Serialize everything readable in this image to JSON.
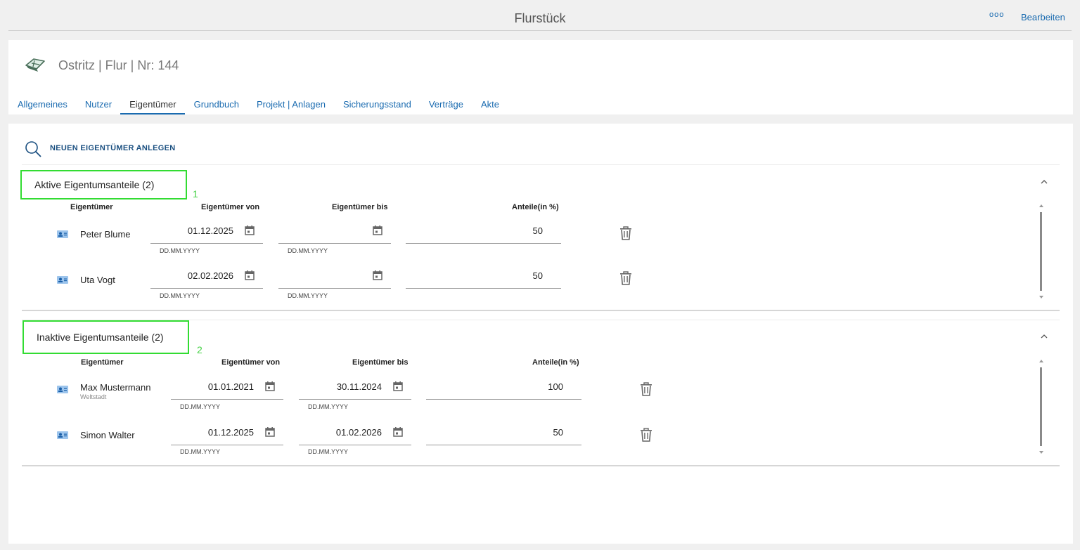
{
  "header": {
    "title": "Flurstück",
    "more_label": "ooo",
    "edit_label": "Bearbeiten"
  },
  "record": {
    "title": "Ostritz | Flur | Nr: 144"
  },
  "tabs": [
    {
      "label": "Allgemeines"
    },
    {
      "label": "Nutzer"
    },
    {
      "label": "Eigentümer"
    },
    {
      "label": "Grundbuch"
    },
    {
      "label": "Projekt | Anlagen"
    },
    {
      "label": "Sicherungsstand"
    },
    {
      "label": "Verträge"
    },
    {
      "label": "Akte"
    }
  ],
  "active_tab": "Eigentümer",
  "actions": {
    "new_owner_label": "NEUEN EIGENTÜMER ANLEGEN"
  },
  "columns": {
    "owner": "Eigentümer",
    "from": "Eigentümer von",
    "to": "Eigentümer bis",
    "share": "Anteile(in %)"
  },
  "date_hint": "DD.MM.YYYY",
  "sections": {
    "active": {
      "title": "Aktive Eigentumsanteile (2)",
      "marker": "1",
      "rows": [
        {
          "name": "Peter Blume",
          "from": "01.12.2025",
          "to": "",
          "share": "50"
        },
        {
          "name": "Uta Vogt",
          "from": "02.02.2026",
          "to": "",
          "share": "50"
        }
      ]
    },
    "inactive": {
      "title": "Inaktive Eigentumsanteile (2)",
      "marker": "2",
      "rows": [
        {
          "name": "Max Mustermann",
          "subtitle": "Weltstadt",
          "from": "01.01.2021",
          "to": "30.11.2024",
          "share": "100"
        },
        {
          "name": "Simon Walter",
          "from": "01.12.2025",
          "to": "01.02.2026",
          "share": "50"
        }
      ]
    }
  },
  "colors": {
    "accent": "#1a6bb0",
    "highlight": "#32dc32",
    "marker": "#46d246"
  }
}
